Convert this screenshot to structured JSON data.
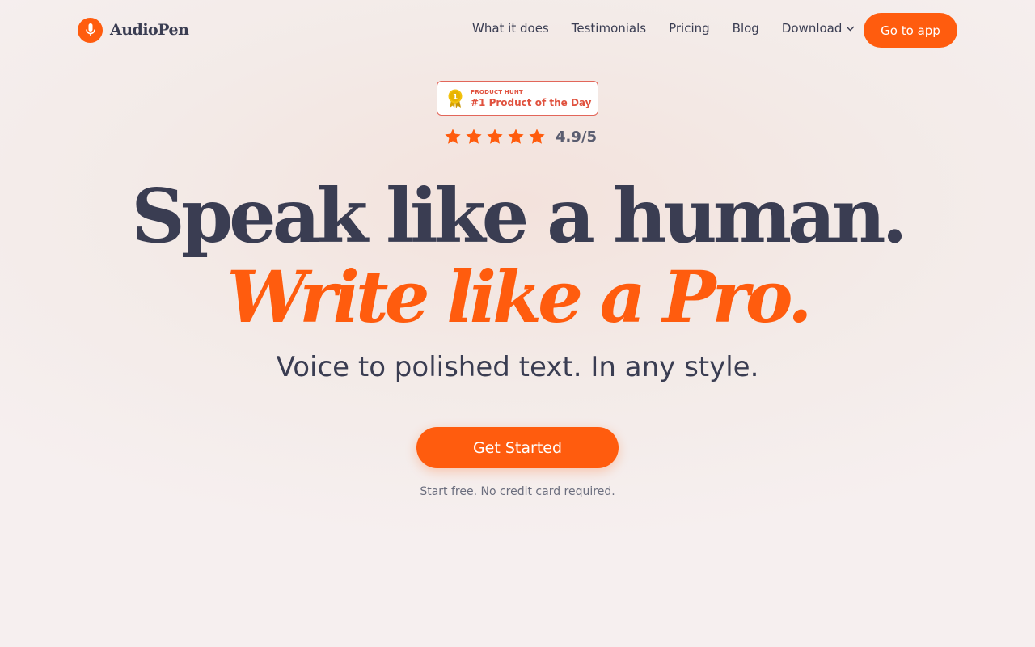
{
  "brand": {
    "name": "AudioPen",
    "accent": "#ff5c0e",
    "icon": "microphone-icon"
  },
  "nav": {
    "links": [
      "What it does",
      "Testimonials",
      "Pricing",
      "Blog"
    ],
    "download_label": "Download",
    "cta_label": "Go to app"
  },
  "badge": {
    "small": "PRODUCT HUNT",
    "big": "#1 Product of the Day",
    "medal_number": "1"
  },
  "rating": {
    "stars": 5,
    "value": "4.9/5"
  },
  "hero": {
    "headline": "Speak like a human.",
    "headline_accent": "Write like a Pro.",
    "tagline": "Voice to polished text. In any style.",
    "cta_label": "Get Started",
    "note": "Start free. No credit card required."
  }
}
